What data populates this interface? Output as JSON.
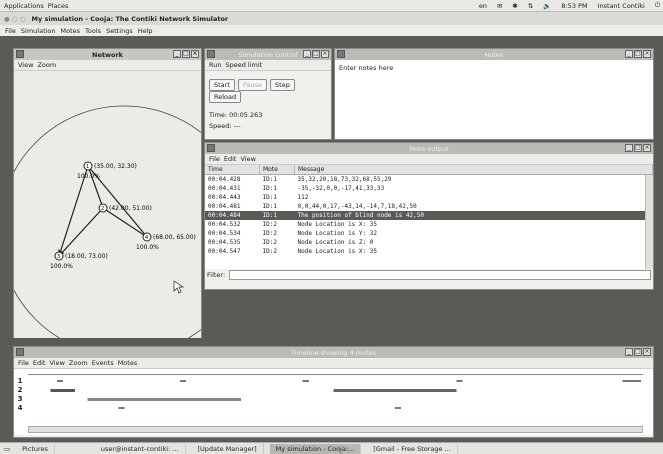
{
  "top_panel": {
    "applications": "Applications",
    "places": "Places",
    "kbd": "en",
    "time": "8:53 PM",
    "user": "Instant Contiki"
  },
  "app": {
    "title": "My simulation - Cooja: The Contiki Network Simulator",
    "menu": [
      "File",
      "Simulation",
      "Motes",
      "Tools",
      "Settings",
      "Help"
    ]
  },
  "network": {
    "title": "Network",
    "menu": [
      "View",
      "Zoom"
    ],
    "nodes": [
      {
        "id": "1",
        "label": "(35.00, 32.30)",
        "pct": "100.0%"
      },
      {
        "id": "2",
        "label": "(42.00, 51.00)",
        "pct": ""
      },
      {
        "id": "4",
        "label": "(68.00, 65.00)",
        "pct": "100.0%"
      },
      {
        "id": "3",
        "label": "(18.00, 73.00)",
        "pct": "100.0%"
      }
    ]
  },
  "sim_control": {
    "title": "Simulation control",
    "menu": [
      "Run",
      "Speed limit"
    ],
    "buttons": {
      "start": "Start",
      "pause": "Pause",
      "step": "Step",
      "reload": "Reload"
    },
    "time": "Time: 00:05.263",
    "speed": "Speed: ---"
  },
  "notes": {
    "title": "Notes",
    "text": "Enter notes here"
  },
  "mote_output": {
    "title": "Mote output",
    "menu": [
      "File",
      "Edit",
      "View"
    ],
    "columns": [
      "Time",
      "Mote",
      "Message"
    ],
    "rows": [
      {
        "time": "00:04.428",
        "mote": "ID:1",
        "msg": "35,32,20,18,73,32,68,55,29",
        "sel": false
      },
      {
        "time": "00:04.431",
        "mote": "ID:1",
        "msg": "-35,-32,0,0,-17,41,33,33",
        "sel": false
      },
      {
        "time": "00:04.443",
        "mote": "ID:1",
        "msg": "112",
        "sel": false
      },
      {
        "time": "00:04.481",
        "mote": "ID:1",
        "msg": "0,0,44,0,17,-43,14,-14,7,18,42,50",
        "sel": false
      },
      {
        "time": "00:04.484",
        "mote": "ID:1",
        "msg": "The position of blind node is 42,50",
        "sel": true
      },
      {
        "time": "00:04.532",
        "mote": "ID:2",
        "msg": "Node Location is X: 35",
        "sel": false
      },
      {
        "time": "00:04.534",
        "mote": "ID:2",
        "msg": "Node Location is Y: 32",
        "sel": false
      },
      {
        "time": "00:04.535",
        "mote": "ID:2",
        "msg": "Node Location is Z: 0",
        "sel": false
      },
      {
        "time": "00:04.547",
        "mote": "ID:2",
        "msg": "Node Location is X: 35",
        "sel": false
      }
    ],
    "filter_label": "Filter:"
  },
  "timeline": {
    "title": "Timeline showing 4 motes",
    "menu": [
      "File",
      "Edit",
      "View",
      "Zoom",
      "Events",
      "Motes"
    ],
    "rows": [
      "1",
      "2",
      "3",
      "4"
    ]
  },
  "taskbar": {
    "items": [
      "Pictures",
      "user@instant-contiki: ...",
      "[Update Manager]",
      "My simulation - Cooja:...",
      "[Gmail - Free Storage ..."
    ]
  }
}
